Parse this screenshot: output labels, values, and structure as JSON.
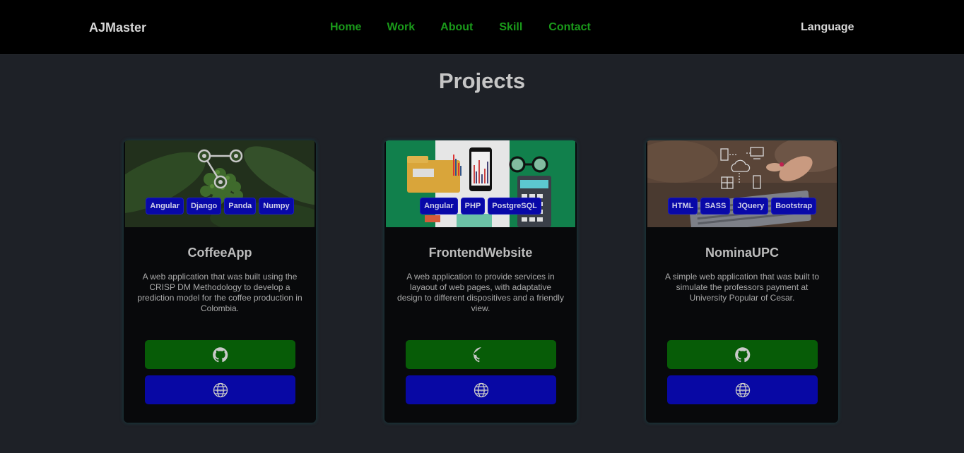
{
  "nav": {
    "brand": "AJMaster",
    "links": [
      "Home",
      "Work",
      "About",
      "Skill",
      "Contact"
    ],
    "language": "Language"
  },
  "page": {
    "title": "Projects"
  },
  "projects": [
    {
      "title": "CoffeeApp",
      "description": "A web application that was built using the CRISP DM Methodology to develop a prediction model for the coffee production in Colombia.",
      "tags": [
        "Angular",
        "Django",
        "Panda",
        "Numpy"
      ],
      "github_icon": "github-icon",
      "web_icon": "globe-icon"
    },
    {
      "title": "FrontendWebsite",
      "description": "A web application to provide services in layaout of web pages, with adaptative design to different dispositives and a friendly view.",
      "tags": [
        "Angular",
        "PHP",
        "PostgreSQL"
      ],
      "github_icon": "github-icon",
      "web_icon": "globe-icon"
    },
    {
      "title": "NominaUPC",
      "description": "A simple web application that was built to simulate the professors payment at University Popular of Cesar.",
      "tags": [
        "HTML",
        "SASS",
        "JQuery",
        "Bootstrap"
      ],
      "github_icon": "github-icon",
      "web_icon": "globe-icon"
    }
  ],
  "colors": {
    "nav_link": "#1a9a1a",
    "github_button": "#075c07",
    "web_button": "#0808a4",
    "tag": "#0808a8"
  }
}
